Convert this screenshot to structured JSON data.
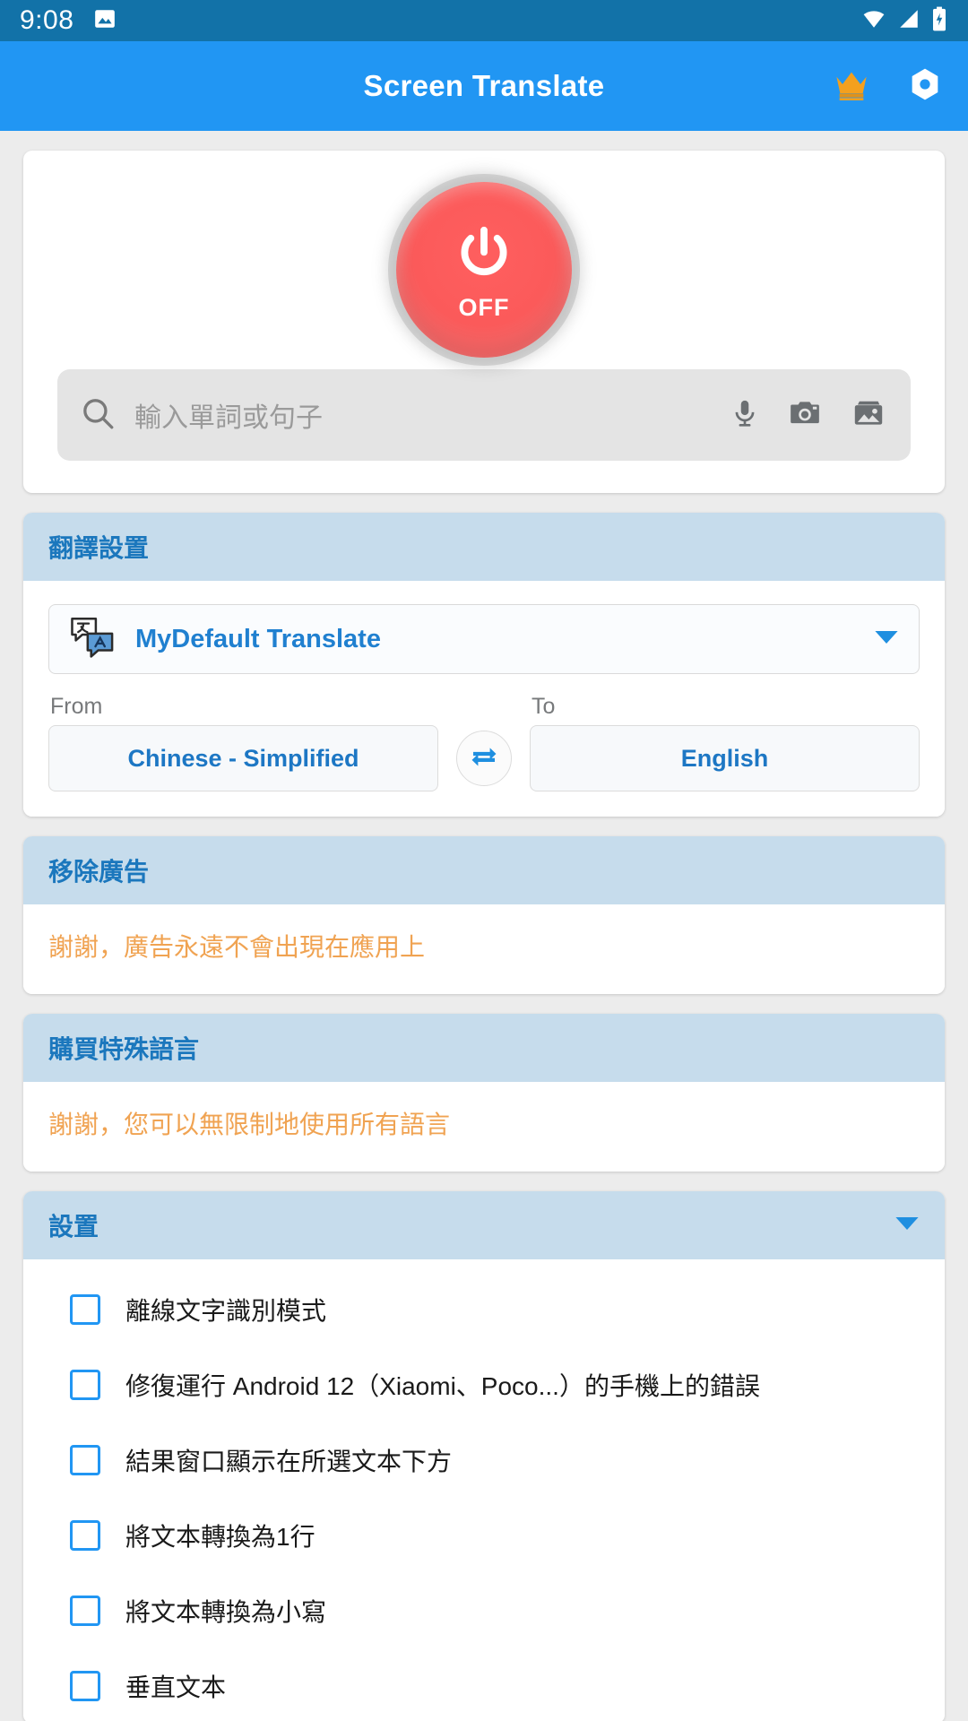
{
  "status_bar": {
    "time": "9:08",
    "notification_icons": [
      "image-notification-icon"
    ],
    "system_icons": [
      "wifi-icon",
      "cellular-signal-icon",
      "battery-charging-icon"
    ],
    "background_color": "#1272a8"
  },
  "app_bar": {
    "title": "Screen Translate",
    "background_color": "#2196f3",
    "actions": [
      {
        "name": "crown-icon",
        "color": "#f4a01e"
      },
      {
        "name": "gear-icon",
        "color": "#ffffff"
      }
    ]
  },
  "power": {
    "state_label": "OFF",
    "glyph": "power-icon",
    "color": "#fb5a5a"
  },
  "search": {
    "placeholder": "輸入單詞或句子",
    "value": "",
    "icons": [
      "search-icon",
      "microphone-icon",
      "camera-icon",
      "gallery-icon"
    ]
  },
  "translate_settings": {
    "header": "翻譯設置",
    "engine": {
      "label": "MyDefault Translate",
      "icon": "translate-bubbles-icon",
      "arrow": "chevron-down-icon"
    },
    "from": {
      "caption": "From",
      "value": "Chinese - Simplified"
    },
    "to": {
      "caption": "To",
      "value": "English"
    },
    "swap_icon": "swap-horizontal-icon"
  },
  "remove_ads": {
    "header": "移除廣告",
    "message": "謝謝，廣告永遠不會出現在應用上"
  },
  "buy_languages": {
    "header": "購買特殊語言",
    "message": "謝謝，您可以無限制地使用所有語言"
  },
  "settings": {
    "header": "設置",
    "arrow": "chevron-down-icon",
    "items": [
      {
        "label": "離線文字識別模式",
        "checked": false
      },
      {
        "label": "修復運行 Android 12（Xiaomi、Poco...）的手機上的錯誤",
        "checked": false
      },
      {
        "label": "結果窗口顯示在所選文本下方",
        "checked": false
      },
      {
        "label": "將文本轉換為1行",
        "checked": false
      },
      {
        "label": "將文本轉換為小寫",
        "checked": false
      },
      {
        "label": "垂直文本",
        "checked": false
      }
    ]
  },
  "colors": {
    "accent_blue": "#2196f3",
    "header_blue": "#1b77bd",
    "section_bg": "#c6dcec",
    "orange_text": "#f0a352",
    "page_bg": "#ececec"
  }
}
